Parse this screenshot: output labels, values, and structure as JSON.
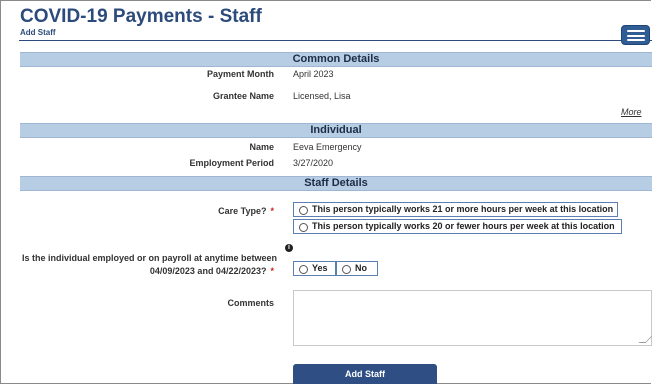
{
  "header": {
    "title": "COVID-19 Payments - Staff",
    "subtitle": "Add Staff",
    "menu_icon": "hamburger-menu-icon"
  },
  "common_details": {
    "heading": "Common Details",
    "payment_month_label": "Payment Month",
    "payment_month_value": "April 2023",
    "grantee_name_label": "Grantee Name",
    "grantee_name_value": "Licensed, Lisa",
    "more_link": "More"
  },
  "individual": {
    "heading": "Individual",
    "name_label": "Name",
    "name_value": "Eeva Emergency",
    "employment_period_label": "Employment Period",
    "employment_period_value": "3/27/2020"
  },
  "staff_details": {
    "heading": "Staff Details",
    "care_type_label": "Care Type?",
    "required_marker": "*",
    "care_type_options": [
      "This person typically works 21 or more hours per week at this location",
      "This person typically works 20 or fewer hours per week at this location"
    ],
    "employed_question_line1": "Is the individual employed or on payroll at anytime between",
    "employed_question_line2": "04/09/2023 and 04/22/2023?",
    "info_icon": "i",
    "employed_options": [
      "Yes",
      "No"
    ],
    "comments_label": "Comments",
    "comments_value": ""
  },
  "actions": {
    "add_staff_label": "Add Staff"
  },
  "colors": {
    "title_blue": "#2c4b7c",
    "section_bar": "#b7cde3",
    "button_blue": "#2f4f84",
    "required_red": "#d21f1f"
  }
}
